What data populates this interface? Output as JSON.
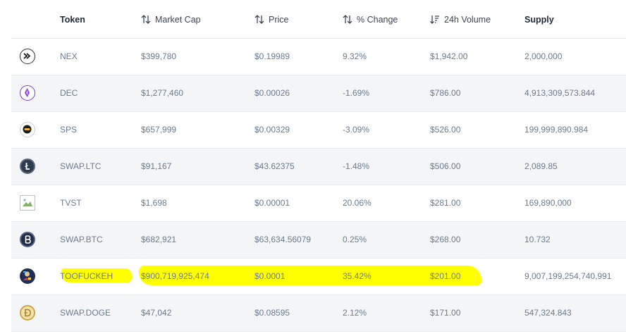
{
  "header": {
    "token": "Token",
    "market_cap": "Market Cap",
    "price": "Price",
    "change": "% Change",
    "volume": "24h Volume",
    "supply": "Supply"
  },
  "rows": [
    {
      "token": "NEX",
      "market_cap": "$399,780",
      "price": "$0.19989",
      "change": "9.32%",
      "volume": "$1,942.00",
      "supply": "2,000,000",
      "icon": "nex-arrow-icon"
    },
    {
      "token": "DEC",
      "market_cap": "$1,277,460",
      "price": "$0.00026",
      "change": "-1.69%",
      "volume": "$786.00",
      "supply": "4,913,309,573.844",
      "icon": "dec-crystal-icon"
    },
    {
      "token": "SPS",
      "market_cap": "$657,999",
      "price": "$0.00329",
      "change": "-3.09%",
      "volume": "$526.00",
      "supply": "199,999,890.984",
      "icon": "sps-orb-icon"
    },
    {
      "token": "SWAP.LTC",
      "market_cap": "$91,167",
      "price": "$43.62375",
      "change": "-1.48%",
      "volume": "$506.00",
      "supply": "2,089.85",
      "icon": "litecoin-icon"
    },
    {
      "token": "TVST",
      "market_cap": "$1,698",
      "price": "$0.00001",
      "change": "20.06%",
      "volume": "$281.00",
      "supply": "169,890,000",
      "icon": "broken-image-icon"
    },
    {
      "token": "SWAP.BTC",
      "market_cap": "$682,921",
      "price": "$63,634.56079",
      "change": "0.25%",
      "volume": "$268.00",
      "supply": "10.732",
      "icon": "bitcoin-icon"
    },
    {
      "token": "TOOFUCKEH",
      "market_cap": "$900,719,925,474",
      "price": "$0.0001",
      "change": "35.42%",
      "volume": "$201.00",
      "supply": "9,007,199,254,740,991",
      "icon": "toofuckeh-logo-icon"
    },
    {
      "token": "SWAP.DOGE",
      "market_cap": "$47,042",
      "price": "$0.08595",
      "change": "2.12%",
      "volume": "$171.00",
      "supply": "547,324.843",
      "icon": "dogecoin-icon"
    }
  ],
  "colors": {
    "highlight": "#ffff00",
    "row_alt_bg": "#f4f5f7",
    "text_muted": "#6b7b90",
    "header_text": "#1f2a37"
  }
}
